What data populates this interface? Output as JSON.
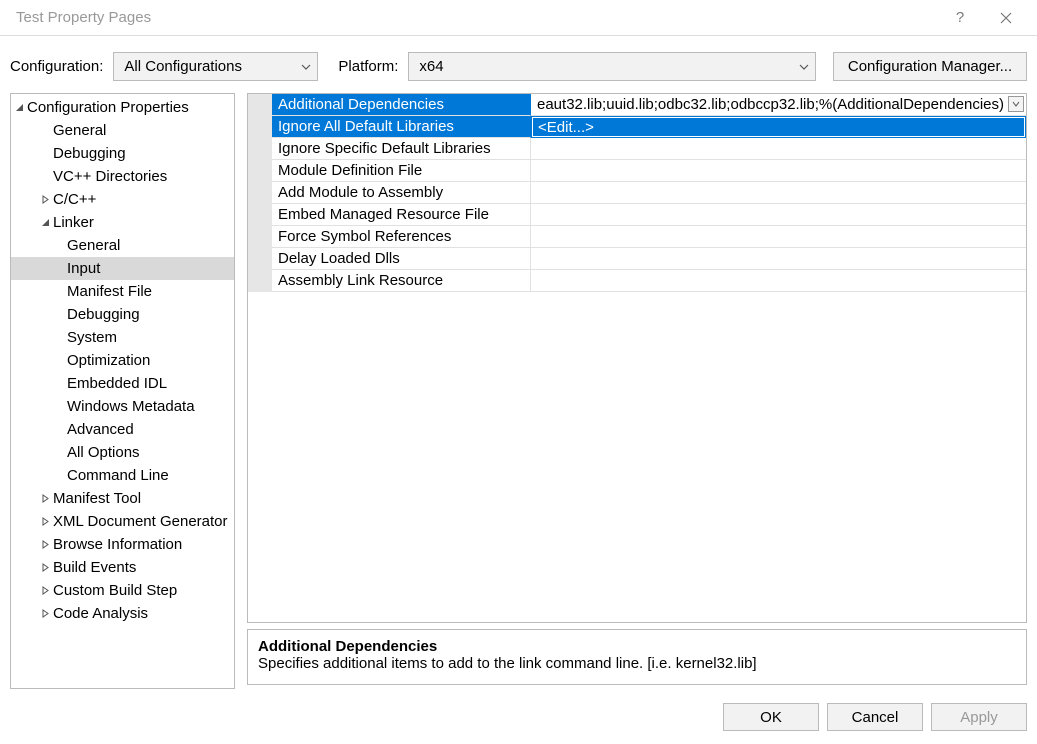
{
  "titlebar": {
    "title": "Test Property Pages",
    "help": "?"
  },
  "toprow": {
    "configLabel": "Configuration:",
    "configValue": "All Configurations",
    "platformLabel": "Platform:",
    "platformValue": "x64",
    "configMgrBtn": "Configuration Manager..."
  },
  "tree": {
    "root": "Configuration Properties",
    "items": [
      {
        "label": "General",
        "level": 1
      },
      {
        "label": "Debugging",
        "level": 1
      },
      {
        "label": "VC++ Directories",
        "level": 1
      },
      {
        "label": "C/C++",
        "level": 1,
        "expandable": "closed"
      },
      {
        "label": "Linker",
        "level": 1,
        "expandable": "open"
      },
      {
        "label": "General",
        "level": 2
      },
      {
        "label": "Input",
        "level": 2,
        "selected": true
      },
      {
        "label": "Manifest File",
        "level": 2
      },
      {
        "label": "Debugging",
        "level": 2
      },
      {
        "label": "System",
        "level": 2
      },
      {
        "label": "Optimization",
        "level": 2
      },
      {
        "label": "Embedded IDL",
        "level": 2
      },
      {
        "label": "Windows Metadata",
        "level": 2
      },
      {
        "label": "Advanced",
        "level": 2
      },
      {
        "label": "All Options",
        "level": 2
      },
      {
        "label": "Command Line",
        "level": 2
      },
      {
        "label": "Manifest Tool",
        "level": 1,
        "expandable": "closed"
      },
      {
        "label": "XML Document Generator",
        "level": 1,
        "expandable": "closed"
      },
      {
        "label": "Browse Information",
        "level": 1,
        "expandable": "closed"
      },
      {
        "label": "Build Events",
        "level": 1,
        "expandable": "closed"
      },
      {
        "label": "Custom Build Step",
        "level": 1,
        "expandable": "closed"
      },
      {
        "label": "Code Analysis",
        "level": 1,
        "expandable": "closed"
      }
    ]
  },
  "grid": {
    "rows": [
      {
        "label": "Additional Dependencies",
        "value": "eaut32.lib;uuid.lib;odbc32.lib;odbccp32.lib;%(AdditionalDependencies)",
        "state": "selected"
      },
      {
        "label": "Ignore All Default Libraries",
        "value": "<Edit...>",
        "state": "editing"
      },
      {
        "label": "Ignore Specific Default Libraries",
        "value": ""
      },
      {
        "label": "Module Definition File",
        "value": ""
      },
      {
        "label": "Add Module to Assembly",
        "value": ""
      },
      {
        "label": "Embed Managed Resource File",
        "value": ""
      },
      {
        "label": "Force Symbol References",
        "value": ""
      },
      {
        "label": "Delay Loaded Dlls",
        "value": ""
      },
      {
        "label": "Assembly Link Resource",
        "value": ""
      }
    ]
  },
  "desc": {
    "title": "Additional Dependencies",
    "text": "Specifies additional items to add to the link command line. [i.e. kernel32.lib]"
  },
  "footer": {
    "ok": "OK",
    "cancel": "Cancel",
    "apply": "Apply"
  }
}
